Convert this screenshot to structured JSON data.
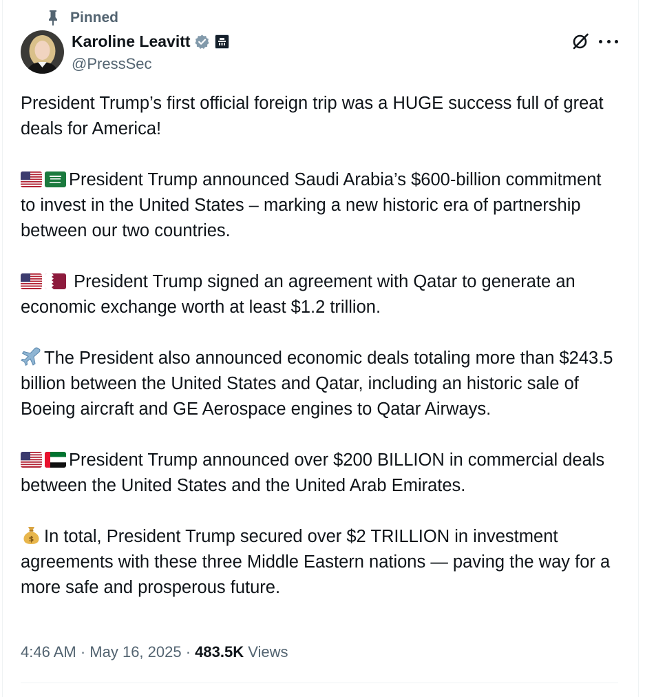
{
  "pinned_label": "Pinned",
  "author": {
    "name": "Karoline Leavitt",
    "handle": "@PressSec"
  },
  "paragraphs": {
    "p1": "President Trump’s first official foreign trip was a HUGE success full of great deals for America!",
    "p2": "President Trump announced Saudi Arabia’s $600-billion commitment to invest in the United States – marking a new historic era of partnership between our two countries.",
    "p3": " President Trump signed an agreement with Qatar to generate an economic exchange worth at least $1.2 trillion.",
    "p4": "The President also announced economic deals totaling more than $243.5 billion between the United States and Qatar, including an historic sale of Boeing aircraft and GE Aerospace engines to Qatar Airways.",
    "p5": "President Trump announced over $200 BILLION in commercial deals between the United States and the United Arab Emirates.",
    "p6": "In total, President Trump secured over $2 TRILLION in investment agreements with these three Middle Eastern nations — paving the way for a more safe and prosperous future."
  },
  "meta": {
    "time": "4:46 AM",
    "date": "May 16, 2025",
    "views_count": "483.5K",
    "views_label": " Views"
  },
  "icons": {
    "pin": "pin-icon",
    "verified": "verified-badge-icon",
    "affiliation": "white-house-affiliation-icon",
    "grok": "grok-icon",
    "more": "more-options-icon",
    "flags": [
      "us-flag",
      "saudi-flag",
      "qatar-flag",
      "uae-flag"
    ],
    "airplane": "airplane-emoji",
    "moneybag": "money-bag-emoji"
  },
  "colors": {
    "text": "#0f1419",
    "secondary": "#536471",
    "divider": "#eff3f4",
    "verified_gray": "#829aab"
  }
}
